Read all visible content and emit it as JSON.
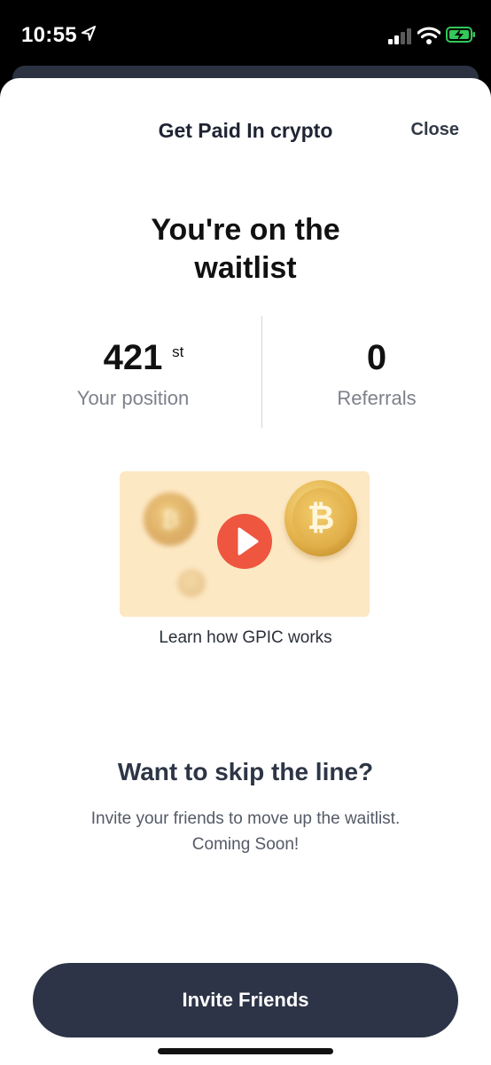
{
  "status_bar": {
    "time": "10:55",
    "icons": [
      "location-arrow-icon",
      "cellular-signal-icon",
      "wifi-icon",
      "battery-charging-icon"
    ],
    "battery_color": "#34c759"
  },
  "header": {
    "title": "Get Paid In crypto",
    "close_label": "Close"
  },
  "waitlist": {
    "headline_line1": "You're on the",
    "headline_line2": "waitlist"
  },
  "stats": {
    "position_value": "421",
    "position_suffix": "st",
    "position_label": "Your position",
    "referrals_value": "0",
    "referrals_label": "Referrals"
  },
  "video": {
    "caption": "Learn how GPIC works",
    "icons": [
      "bitcoin-coin-icon",
      "play-icon"
    ],
    "coin_glyph": "₿",
    "background_color": "#fde8c4",
    "play_color": "#ee5640"
  },
  "skip": {
    "title": "Want to skip the line?",
    "text_line1": "Invite your friends to move up the waitlist.",
    "text_line2": "Coming Soon!"
  },
  "cta": {
    "label": "Invite Friends",
    "color": "#2d3447"
  }
}
